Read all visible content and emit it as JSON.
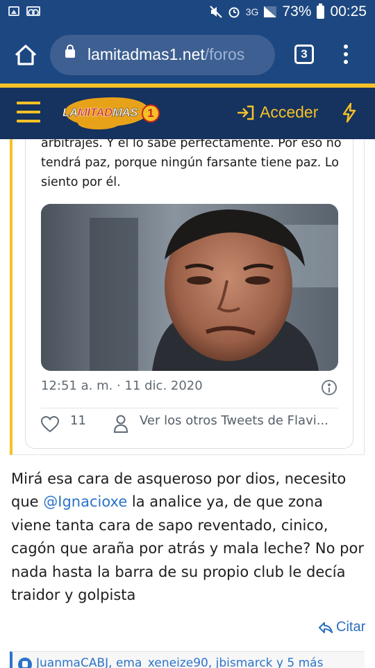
{
  "status_bar": {
    "battery": "73%",
    "time": "00:25",
    "network": "3G"
  },
  "browser": {
    "url_domain": "lamitadmas1.net",
    "url_path": "/foros",
    "tab_count": "3"
  },
  "site": {
    "logo_text": "LAMITADMAS1",
    "logo_la": "LA",
    "logo_mitad": "MITAD",
    "logo_mas": "MAS",
    "logo_one": "1",
    "login_label": "Acceder",
    "accent_color": "#f5c127",
    "header_color": "#16325e"
  },
  "tweet": {
    "text": "arbitrajes. Y él lo sabe perfectamente. Por eso no tendrá paz, porque ningún farsante tiene paz. Lo siento por él.",
    "timestamp": "12:51 a. m. · 11 dic. 2020",
    "likes": "11",
    "more_tweets_label": "Ver los otros Tweets de Flavi..."
  },
  "post": {
    "text_before": "Mirá esa cara de asqueroso por dios, necesito que ",
    "mention": "@Ignacioxe",
    "text_after": " la analice ya, de que zona viene tanta cara de sapo reventado, cinico, cagón que araña por atrás y mala leche? No por nada hasta la barra de su propio club le decía traidor y golpista",
    "quote_label": "Citar"
  },
  "reactions": {
    "text": "JuanmaCABJ, ema_xeneize90, jbismarck y 5 más"
  }
}
